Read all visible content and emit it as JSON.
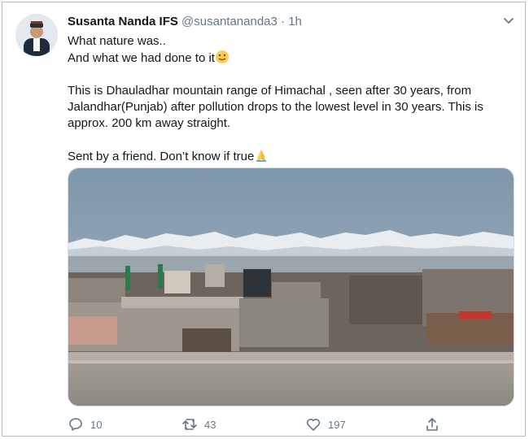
{
  "tweet": {
    "author_name": "Susanta Nanda IFS",
    "handle": "@susantananda3",
    "separator": "·",
    "time": "1h",
    "lines": [
      "What nature was..",
      "And what we had done to it",
      "This is Dhauladhar mountain range of  Himachal , seen after 30 years, from Jalandhar(Punjab) after pollution drops to the lowest level in 30 years. This is approx. 200 km away straight.",
      "Sent by a friend. Don’t know if true"
    ],
    "emojis": [
      "smiling-face-emoji",
      "folded-hands-emoji"
    ]
  },
  "actions": {
    "reply_count": "10",
    "retweet_count": "43",
    "like_count": "197"
  },
  "icons": [
    "chevron-down-icon",
    "reply-icon",
    "retweet-icon",
    "like-icon",
    "share-icon"
  ],
  "colors": {
    "text": "#14171a",
    "secondary": "#657786",
    "border": "#b9b9b9"
  }
}
